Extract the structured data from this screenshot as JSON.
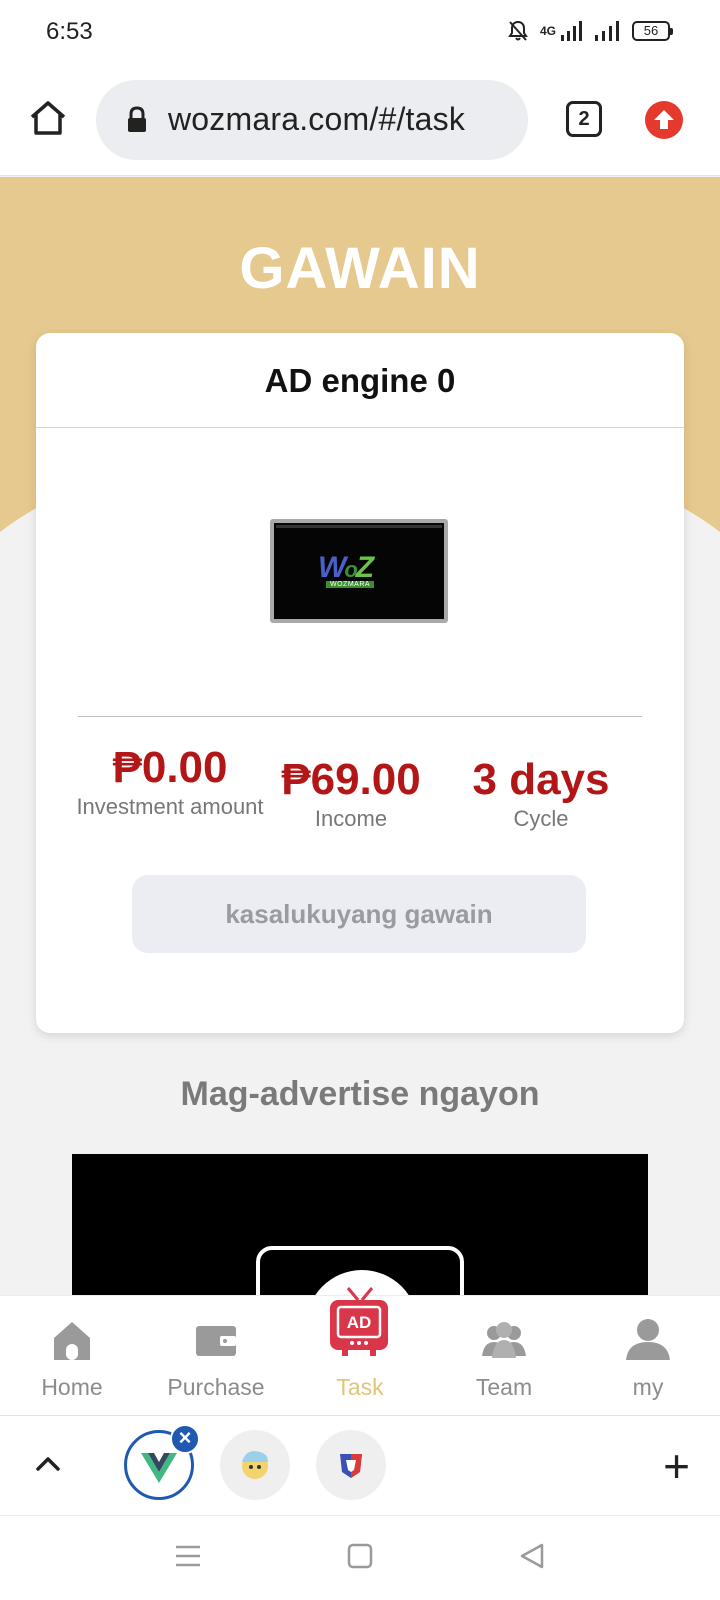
{
  "status_bar": {
    "time": "6:53",
    "network": "4G",
    "battery": "56"
  },
  "browser": {
    "url": "wozmara.com/#/task",
    "tab_count": "2",
    "home_icon": "home-icon",
    "lock_icon": "lock-icon",
    "update_icon": "arrow-up-icon"
  },
  "page": {
    "title": "GAWAIN",
    "accent_color": "#e6c98e"
  },
  "card": {
    "title": "AD engine 0",
    "image_alt": "WoZ wozmara screen",
    "logo_text": {
      "w": "W",
      "o": "o",
      "z": "Z",
      "sub": "WOZMARA"
    },
    "stats": [
      {
        "value": "₱0.00",
        "label": "Investment amount"
      },
      {
        "value": "₱69.00",
        "label": "Income"
      },
      {
        "value": "3 days",
        "label": "Cycle"
      }
    ],
    "button_label": "kasalukuyang gawain"
  },
  "section": {
    "title": "Mag-advertise ngayon"
  },
  "tabbar": {
    "items": [
      {
        "label": "Home",
        "icon": "home-icon"
      },
      {
        "label": "Purchase",
        "icon": "wallet-icon"
      },
      {
        "label": "Task",
        "icon": "ad-tv-icon",
        "badge": "AD"
      },
      {
        "label": "Team",
        "icon": "team-icon"
      },
      {
        "label": "my",
        "icon": "user-icon"
      }
    ],
    "active_index": 2,
    "active_color": "#e0c47a"
  },
  "browser_bottom": {
    "close_badge": "×",
    "plus": "+"
  }
}
